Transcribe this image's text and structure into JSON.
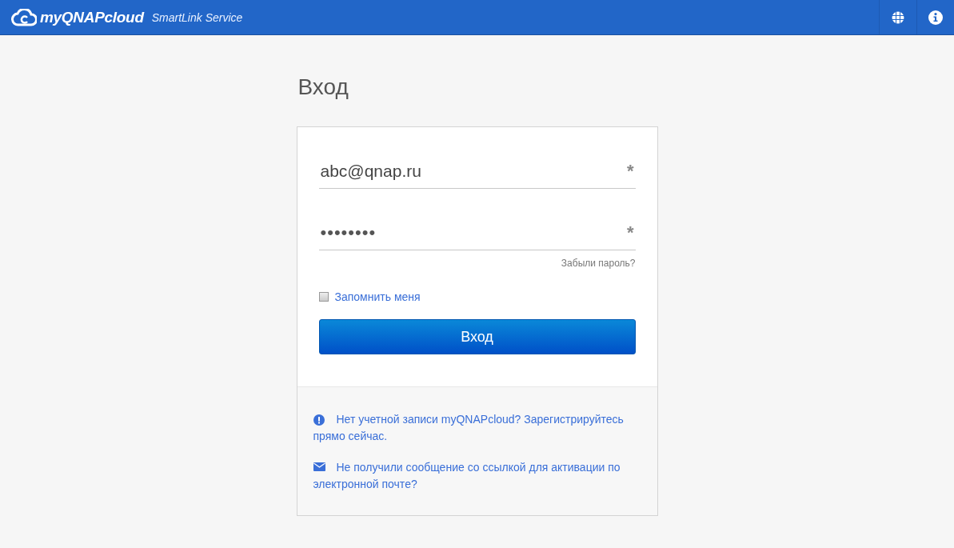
{
  "header": {
    "brand": "myQNAPcloud",
    "subtitle": "SmartLink Service"
  },
  "title": "Вход",
  "form": {
    "email": {
      "value": "abc@qnap.ru",
      "required_mark": "*"
    },
    "password": {
      "value": "••••••••",
      "required_mark": "*"
    },
    "forgot_link": "Забыли пароль?",
    "remember": {
      "label": "Запомнить меня",
      "checked": false
    },
    "submit": "Вход"
  },
  "help_links": [
    {
      "kind": "alert",
      "text": "Нет учетной записи myQNAPcloud? Зарегистрируйтесь прямо сейчас."
    },
    {
      "kind": "mail",
      "text": "Не получили сообщение со ссылкой для активации по электронной почте?"
    }
  ]
}
